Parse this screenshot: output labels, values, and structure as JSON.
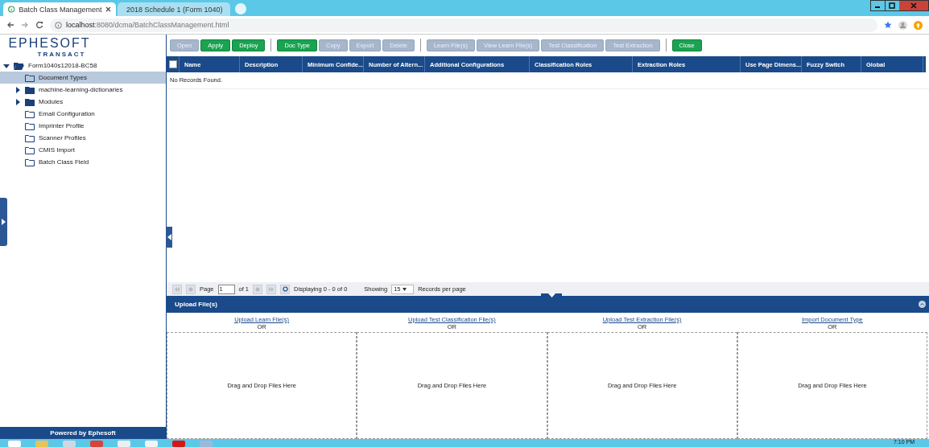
{
  "browser": {
    "tabs": [
      {
        "title": "Batch Class Management",
        "selected": true
      },
      {
        "title": "2018 Schedule 1 (Form 1040)",
        "selected": false
      }
    ],
    "url_host": "localhost",
    "url_rest": ":8080/dcma/BatchClassManagement.html"
  },
  "sidebar": {
    "logo": "EPHESOFT",
    "logo_sub": "TRANSACT",
    "tree": [
      {
        "label": "Form1040s12018-BC58",
        "kind": "branch",
        "expanded": true,
        "selected": false,
        "children": [
          {
            "label": "Document Types",
            "kind": "leaf",
            "selected": true
          },
          {
            "label": "machine-learning-dictionaries",
            "kind": "branch",
            "expanded": false,
            "selected": false
          },
          {
            "label": "Modules",
            "kind": "branch",
            "expanded": false,
            "selected": false
          },
          {
            "label": "Email Configuration",
            "kind": "leaf",
            "selected": false
          },
          {
            "label": "Imprinter Profile",
            "kind": "leaf",
            "selected": false
          },
          {
            "label": "Scanner Profiles",
            "kind": "leaf",
            "selected": false
          },
          {
            "label": "CMIS Import",
            "kind": "leaf",
            "selected": false
          },
          {
            "label": "Batch Class Field",
            "kind": "leaf",
            "selected": false
          }
        ]
      }
    ],
    "footer": "Powered by Ephesoft"
  },
  "toolbar": [
    [
      {
        "label": "Open",
        "disabled": true
      },
      {
        "label": "Apply",
        "disabled": false
      },
      {
        "label": "Deploy",
        "disabled": false
      }
    ],
    [
      {
        "label": "Doc Type",
        "disabled": false
      },
      {
        "label": "Copy",
        "disabled": true
      },
      {
        "label": "Export",
        "disabled": true
      },
      {
        "label": "Delete",
        "disabled": true
      }
    ],
    [
      {
        "label": "Learn File(s)",
        "disabled": true
      },
      {
        "label": "View Learn File(s)",
        "disabled": true
      },
      {
        "label": "Test Classification",
        "disabled": true
      },
      {
        "label": "Test Extraction",
        "disabled": true
      }
    ],
    [
      {
        "label": "Close",
        "disabled": false
      }
    ]
  ],
  "table": {
    "select_all_checked": false,
    "columns": [
      "Name",
      "Description",
      "Minimum Confide...",
      "Number of Altern...",
      "Additional Configurations",
      "Classification Roles",
      "Extraction Roles",
      "Use Page Dimens...",
      "Fuzzy Switch",
      "Global"
    ],
    "empty_message": "No Records Found."
  },
  "pager": {
    "page_label": "Page",
    "page": "1",
    "of": "of 1",
    "displaying": "Displaying 0 - 0 of 0",
    "showing": "Showing",
    "per_page": "15",
    "records_label": "Records per page"
  },
  "upload": {
    "title": "Upload File(s)",
    "columns": [
      {
        "link": "Upload Learn File(s)",
        "or": "OR",
        "drop": "Drag and Drop Files Here"
      },
      {
        "link": "Upload Test Classification File(s)",
        "or": "OR",
        "drop": "Drag and Drop Files Here"
      },
      {
        "link": "Upload Test Extraction File(s)",
        "or": "OR",
        "drop": "Drag and Drop Files Here"
      },
      {
        "link": "Import Document Type",
        "or": "OR",
        "drop": "Drag and Drop Files Here"
      }
    ]
  },
  "taskbar": {
    "time": "7:10 PM"
  }
}
